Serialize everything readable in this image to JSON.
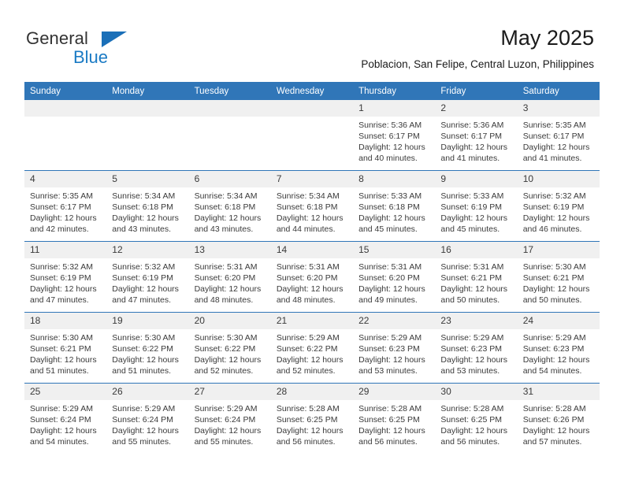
{
  "brand": {
    "name_part1": "General",
    "name_part2": "Blue",
    "triangle_icon": "triangle-icon",
    "color_dark": "#333333",
    "color_blue": "#1a7ac4"
  },
  "header": {
    "title": "May 2025",
    "subtitle": "Poblacion, San Felipe, Central Luzon, Philippines"
  },
  "theme": {
    "header_blue": "#3076b8",
    "daynum_gray": "#f0f0f0",
    "text": "#3a3a3a"
  },
  "weekday_headers": [
    "Sunday",
    "Monday",
    "Tuesday",
    "Wednesday",
    "Thursday",
    "Friday",
    "Saturday"
  ],
  "labels": {
    "sunrise_prefix": "Sunrise:",
    "sunset_prefix": "Sunset:",
    "daylight_prefix": "Daylight:"
  },
  "weeks": [
    [
      {
        "day": "",
        "sunrise": "",
        "sunset": "",
        "daylight": "",
        "empty": true
      },
      {
        "day": "",
        "sunrise": "",
        "sunset": "",
        "daylight": "",
        "empty": true
      },
      {
        "day": "",
        "sunrise": "",
        "sunset": "",
        "daylight": "",
        "empty": true
      },
      {
        "day": "",
        "sunrise": "",
        "sunset": "",
        "daylight": "",
        "empty": true
      },
      {
        "day": "1",
        "sunrise": "Sunrise: 5:36 AM",
        "sunset": "Sunset: 6:17 PM",
        "daylight": "Daylight: 12 hours and 40 minutes.",
        "empty": false
      },
      {
        "day": "2",
        "sunrise": "Sunrise: 5:36 AM",
        "sunset": "Sunset: 6:17 PM",
        "daylight": "Daylight: 12 hours and 41 minutes.",
        "empty": false
      },
      {
        "day": "3",
        "sunrise": "Sunrise: 5:35 AM",
        "sunset": "Sunset: 6:17 PM",
        "daylight": "Daylight: 12 hours and 41 minutes.",
        "empty": false
      }
    ],
    [
      {
        "day": "4",
        "sunrise": "Sunrise: 5:35 AM",
        "sunset": "Sunset: 6:17 PM",
        "daylight": "Daylight: 12 hours and 42 minutes.",
        "empty": false
      },
      {
        "day": "5",
        "sunrise": "Sunrise: 5:34 AM",
        "sunset": "Sunset: 6:18 PM",
        "daylight": "Daylight: 12 hours and 43 minutes.",
        "empty": false
      },
      {
        "day": "6",
        "sunrise": "Sunrise: 5:34 AM",
        "sunset": "Sunset: 6:18 PM",
        "daylight": "Daylight: 12 hours and 43 minutes.",
        "empty": false
      },
      {
        "day": "7",
        "sunrise": "Sunrise: 5:34 AM",
        "sunset": "Sunset: 6:18 PM",
        "daylight": "Daylight: 12 hours and 44 minutes.",
        "empty": false
      },
      {
        "day": "8",
        "sunrise": "Sunrise: 5:33 AM",
        "sunset": "Sunset: 6:18 PM",
        "daylight": "Daylight: 12 hours and 45 minutes.",
        "empty": false
      },
      {
        "day": "9",
        "sunrise": "Sunrise: 5:33 AM",
        "sunset": "Sunset: 6:19 PM",
        "daylight": "Daylight: 12 hours and 45 minutes.",
        "empty": false
      },
      {
        "day": "10",
        "sunrise": "Sunrise: 5:32 AM",
        "sunset": "Sunset: 6:19 PM",
        "daylight": "Daylight: 12 hours and 46 minutes.",
        "empty": false
      }
    ],
    [
      {
        "day": "11",
        "sunrise": "Sunrise: 5:32 AM",
        "sunset": "Sunset: 6:19 PM",
        "daylight": "Daylight: 12 hours and 47 minutes.",
        "empty": false
      },
      {
        "day": "12",
        "sunrise": "Sunrise: 5:32 AM",
        "sunset": "Sunset: 6:19 PM",
        "daylight": "Daylight: 12 hours and 47 minutes.",
        "empty": false
      },
      {
        "day": "13",
        "sunrise": "Sunrise: 5:31 AM",
        "sunset": "Sunset: 6:20 PM",
        "daylight": "Daylight: 12 hours and 48 minutes.",
        "empty": false
      },
      {
        "day": "14",
        "sunrise": "Sunrise: 5:31 AM",
        "sunset": "Sunset: 6:20 PM",
        "daylight": "Daylight: 12 hours and 48 minutes.",
        "empty": false
      },
      {
        "day": "15",
        "sunrise": "Sunrise: 5:31 AM",
        "sunset": "Sunset: 6:20 PM",
        "daylight": "Daylight: 12 hours and 49 minutes.",
        "empty": false
      },
      {
        "day": "16",
        "sunrise": "Sunrise: 5:31 AM",
        "sunset": "Sunset: 6:21 PM",
        "daylight": "Daylight: 12 hours and 50 minutes.",
        "empty": false
      },
      {
        "day": "17",
        "sunrise": "Sunrise: 5:30 AM",
        "sunset": "Sunset: 6:21 PM",
        "daylight": "Daylight: 12 hours and 50 minutes.",
        "empty": false
      }
    ],
    [
      {
        "day": "18",
        "sunrise": "Sunrise: 5:30 AM",
        "sunset": "Sunset: 6:21 PM",
        "daylight": "Daylight: 12 hours and 51 minutes.",
        "empty": false
      },
      {
        "day": "19",
        "sunrise": "Sunrise: 5:30 AM",
        "sunset": "Sunset: 6:22 PM",
        "daylight": "Daylight: 12 hours and 51 minutes.",
        "empty": false
      },
      {
        "day": "20",
        "sunrise": "Sunrise: 5:30 AM",
        "sunset": "Sunset: 6:22 PM",
        "daylight": "Daylight: 12 hours and 52 minutes.",
        "empty": false
      },
      {
        "day": "21",
        "sunrise": "Sunrise: 5:29 AM",
        "sunset": "Sunset: 6:22 PM",
        "daylight": "Daylight: 12 hours and 52 minutes.",
        "empty": false
      },
      {
        "day": "22",
        "sunrise": "Sunrise: 5:29 AM",
        "sunset": "Sunset: 6:23 PM",
        "daylight": "Daylight: 12 hours and 53 minutes.",
        "empty": false
      },
      {
        "day": "23",
        "sunrise": "Sunrise: 5:29 AM",
        "sunset": "Sunset: 6:23 PM",
        "daylight": "Daylight: 12 hours and 53 minutes.",
        "empty": false
      },
      {
        "day": "24",
        "sunrise": "Sunrise: 5:29 AM",
        "sunset": "Sunset: 6:23 PM",
        "daylight": "Daylight: 12 hours and 54 minutes.",
        "empty": false
      }
    ],
    [
      {
        "day": "25",
        "sunrise": "Sunrise: 5:29 AM",
        "sunset": "Sunset: 6:24 PM",
        "daylight": "Daylight: 12 hours and 54 minutes.",
        "empty": false
      },
      {
        "day": "26",
        "sunrise": "Sunrise: 5:29 AM",
        "sunset": "Sunset: 6:24 PM",
        "daylight": "Daylight: 12 hours and 55 minutes.",
        "empty": false
      },
      {
        "day": "27",
        "sunrise": "Sunrise: 5:29 AM",
        "sunset": "Sunset: 6:24 PM",
        "daylight": "Daylight: 12 hours and 55 minutes.",
        "empty": false
      },
      {
        "day": "28",
        "sunrise": "Sunrise: 5:28 AM",
        "sunset": "Sunset: 6:25 PM",
        "daylight": "Daylight: 12 hours and 56 minutes.",
        "empty": false
      },
      {
        "day": "29",
        "sunrise": "Sunrise: 5:28 AM",
        "sunset": "Sunset: 6:25 PM",
        "daylight": "Daylight: 12 hours and 56 minutes.",
        "empty": false
      },
      {
        "day": "30",
        "sunrise": "Sunrise: 5:28 AM",
        "sunset": "Sunset: 6:25 PM",
        "daylight": "Daylight: 12 hours and 56 minutes.",
        "empty": false
      },
      {
        "day": "31",
        "sunrise": "Sunrise: 5:28 AM",
        "sunset": "Sunset: 6:26 PM",
        "daylight": "Daylight: 12 hours and 57 minutes.",
        "empty": false
      }
    ]
  ]
}
